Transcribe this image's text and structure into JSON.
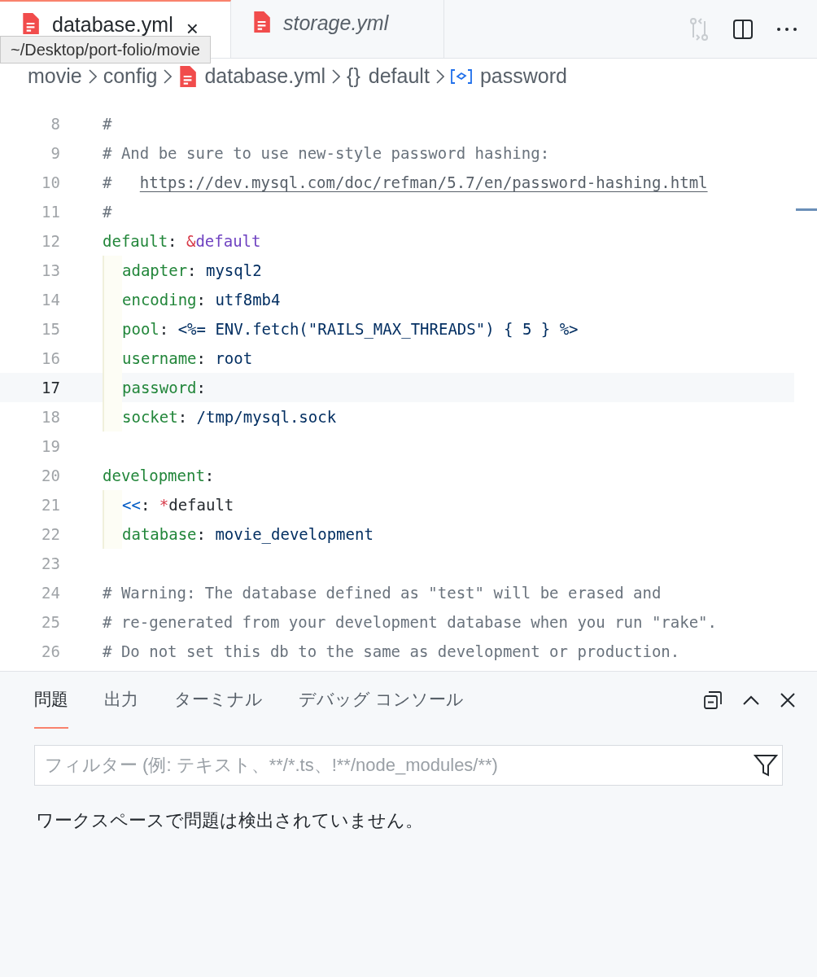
{
  "tabs": [
    {
      "label": "database.yml",
      "selected": true,
      "preview": false,
      "close": "×"
    },
    {
      "label": "storage.yml",
      "selected": false,
      "preview": true
    }
  ],
  "tooltip": "~/Desktop/port-folio/movie",
  "breadcrumbs": [
    {
      "kind": "folder",
      "label": "movie"
    },
    {
      "kind": "folder",
      "label": "config"
    },
    {
      "kind": "file",
      "label": "database.yml"
    },
    {
      "kind": "object",
      "label": "default"
    },
    {
      "kind": "property",
      "label": "password"
    }
  ],
  "object_symbol": "{}",
  "lines": [
    {
      "number": "8",
      "indent": false,
      "current": false,
      "tokens": [
        {
          "kind": "comment",
          "text": "#"
        }
      ]
    },
    {
      "number": "9",
      "indent": false,
      "current": false,
      "tokens": [
        {
          "kind": "comment",
          "text": "# And be sure to use new-style password hashing:"
        }
      ]
    },
    {
      "number": "10",
      "indent": false,
      "current": false,
      "tokens": [
        {
          "kind": "comment",
          "text": "#   "
        },
        {
          "kind": "link",
          "text": "https://dev.mysql.com/doc/refman/5.7/en/password-hashing.html"
        }
      ]
    },
    {
      "number": "11",
      "indent": false,
      "current": false,
      "tokens": [
        {
          "kind": "comment",
          "text": "#"
        }
      ]
    },
    {
      "number": "12",
      "indent": false,
      "current": false,
      "tokens": [
        {
          "kind": "key",
          "text": "default"
        },
        {
          "kind": "plain",
          "text": ": "
        },
        {
          "kind": "sigil",
          "text": "&"
        },
        {
          "kind": "anchor",
          "text": "default"
        }
      ]
    },
    {
      "number": "13",
      "indent": true,
      "current": false,
      "tokens": [
        {
          "kind": "key",
          "text": "adapter"
        },
        {
          "kind": "plain",
          "text": ": "
        },
        {
          "kind": "value",
          "text": "mysql2"
        }
      ]
    },
    {
      "number": "14",
      "indent": true,
      "current": false,
      "tokens": [
        {
          "kind": "key",
          "text": "encoding"
        },
        {
          "kind": "plain",
          "text": ": "
        },
        {
          "kind": "value",
          "text": "utf8mb4"
        }
      ]
    },
    {
      "number": "15",
      "indent": true,
      "current": false,
      "tokens": [
        {
          "kind": "key",
          "text": "pool"
        },
        {
          "kind": "plain",
          "text": ": "
        },
        {
          "kind": "value",
          "text": "<%= ENV.fetch(\"RAILS_MAX_THREADS\") { 5 } %>"
        }
      ]
    },
    {
      "number": "16",
      "indent": true,
      "current": false,
      "tokens": [
        {
          "kind": "key",
          "text": "username"
        },
        {
          "kind": "plain",
          "text": ": "
        },
        {
          "kind": "value",
          "text": "root"
        }
      ]
    },
    {
      "number": "17",
      "indent": true,
      "current": true,
      "tokens": [
        {
          "kind": "key",
          "text": "password"
        },
        {
          "kind": "plain",
          "text": ":"
        }
      ]
    },
    {
      "number": "18",
      "indent": true,
      "current": false,
      "tokens": [
        {
          "kind": "key",
          "text": "socket"
        },
        {
          "kind": "plain",
          "text": ": "
        },
        {
          "kind": "value",
          "text": "/tmp/mysql.sock"
        }
      ]
    },
    {
      "number": "19",
      "indent": false,
      "current": false
    },
    {
      "number": "20",
      "indent": false,
      "current": false,
      "tokens": [
        {
          "kind": "key",
          "text": "development"
        },
        {
          "kind": "plain",
          "text": ":"
        }
      ]
    },
    {
      "number": "21",
      "indent": true,
      "current": false,
      "tokens": [
        {
          "kind": "merge",
          "text": "<<"
        },
        {
          "kind": "plain",
          "text": ": "
        },
        {
          "kind": "sigil",
          "text": "*"
        },
        {
          "kind": "plain",
          "text": "default"
        }
      ]
    },
    {
      "number": "22",
      "indent": true,
      "current": false,
      "tokens": [
        {
          "kind": "key",
          "text": "database"
        },
        {
          "kind": "plain",
          "text": ": "
        },
        {
          "kind": "value",
          "text": "movie_development"
        }
      ]
    },
    {
      "number": "23",
      "indent": false,
      "current": false
    },
    {
      "number": "24",
      "indent": false,
      "current": false,
      "tokens": [
        {
          "kind": "comment",
          "text": "# Warning: The database defined as \"test\" will be erased and"
        }
      ]
    },
    {
      "number": "25",
      "indent": false,
      "current": false,
      "tokens": [
        {
          "kind": "comment",
          "text": "# re-generated from your development database when you run \"rake\"."
        }
      ]
    },
    {
      "number": "26",
      "indent": false,
      "current": false,
      "tokens": [
        {
          "kind": "comment",
          "text": "# Do not set this db to the same as development or production."
        }
      ]
    }
  ],
  "panel": {
    "tabs": [
      {
        "label": "問題",
        "selected": true
      },
      {
        "label": "出力",
        "selected": false
      },
      {
        "label": "ターミナル",
        "selected": false
      },
      {
        "label": "デバッグ コンソール",
        "selected": false
      }
    ],
    "filter": {
      "placeholder": "フィルター (例: テキスト、**/*.ts、!**/node_modules/**)"
    },
    "message": "ワークスペースで問題は検出されていません。"
  }
}
